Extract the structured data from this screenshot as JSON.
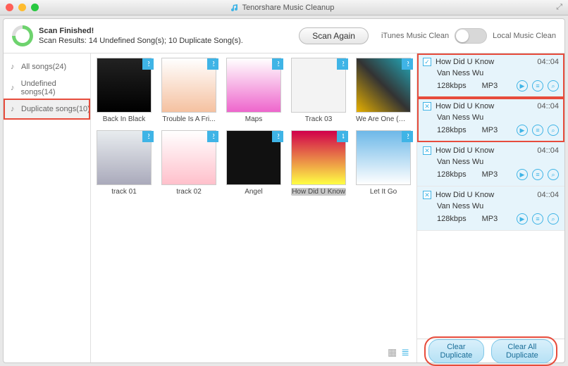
{
  "titlebar": {
    "app_name": "Tenorshare Music Cleanup"
  },
  "status": {
    "heading": "Scan Finished!",
    "detail": "Scan Results: 14 Undefined Song(s); 10 Duplicate Song(s)."
  },
  "toolbar": {
    "scan_again": "Scan Again",
    "mode_left": "iTunes Music Clean",
    "mode_right": "Local Music Clean"
  },
  "sidebar": {
    "items": [
      {
        "label": "All songs(24)"
      },
      {
        "label": "Undefined songs(14)"
      },
      {
        "label": "Duplicate songs(10)"
      }
    ]
  },
  "grid": {
    "items": [
      {
        "title": "Back In Black",
        "badge": "2",
        "art": "a0"
      },
      {
        "title": "Trouble Is A Fri...",
        "badge": "2",
        "art": "a1"
      },
      {
        "title": "Maps",
        "badge": "2",
        "art": "a2"
      },
      {
        "title": "Track 03",
        "badge": "2",
        "art": "a3"
      },
      {
        "title": "We Are One (Ol...",
        "badge": "2",
        "art": "a4"
      },
      {
        "title": "track 01",
        "badge": "2",
        "art": "a5"
      },
      {
        "title": "track 02",
        "badge": "2",
        "art": "a6"
      },
      {
        "title": "Angel",
        "badge": "2",
        "art": "a7"
      },
      {
        "title": "How Did U Know",
        "badge": "4",
        "art": "a8",
        "selected": true
      },
      {
        "title": "Let It Go",
        "badge": "2",
        "art": "a9"
      }
    ]
  },
  "duplicates": {
    "items": [
      {
        "checked": true,
        "mark": "✓",
        "title": "How Did U Know",
        "time": "04::04",
        "artist": "Van Ness Wu",
        "bitrate": "128kbps",
        "format": "MP3"
      },
      {
        "checked": false,
        "mark": "✕",
        "title": "How Did U Know",
        "time": "04::04",
        "artist": "Van Ness Wu",
        "bitrate": "128kbps",
        "format": "MP3"
      },
      {
        "checked": false,
        "mark": "✕",
        "title": "How Did U Know",
        "time": "04::04",
        "artist": "Van Ness Wu",
        "bitrate": "128kbps",
        "format": "MP3"
      },
      {
        "checked": false,
        "mark": "✕",
        "title": "How Did U Know",
        "time": "04::04",
        "artist": "Van Ness Wu",
        "bitrate": "128kbps",
        "format": "MP3"
      }
    ]
  },
  "bottom": {
    "clear_dup": "Clear Duplicate",
    "clear_all": "Clear All Duplicate"
  },
  "colors": {
    "accent": "#3fb4e6",
    "highlight": "#e74c3c"
  }
}
